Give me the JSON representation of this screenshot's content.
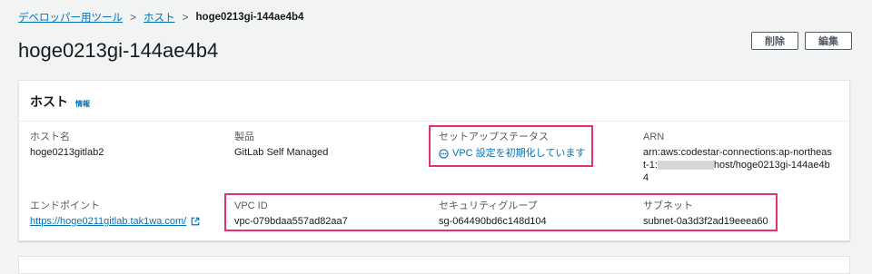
{
  "breadcrumb": {
    "items": [
      "デベロッパー用ツール",
      "ホスト"
    ],
    "separator": ">",
    "current": "hoge0213gi-144ae4b4"
  },
  "page": {
    "title": "hoge0213gi-144ae4b4"
  },
  "actions": {
    "delete_label": "削除",
    "edit_label": "編集"
  },
  "panel": {
    "title": "ホスト",
    "info_label": "情報",
    "fields": {
      "host_name": {
        "label": "ホスト名",
        "value": "hoge0213gitlab2"
      },
      "product": {
        "label": "製品",
        "value": "GitLab Self Managed"
      },
      "setup_status": {
        "label": "セットアップステータス",
        "value": "VPC 設定を初期化しています"
      },
      "arn": {
        "label": "ARN",
        "value_prefix": "arn:aws:codestar-connections:ap-northeast-1:",
        "value_suffix": "host/hoge0213gi-144ae4b4"
      },
      "endpoint": {
        "label": "エンドポイント",
        "value": "https://hoge0211gitlab.tak1wa.com/"
      },
      "vpc_id": {
        "label": "VPC ID",
        "value": "vpc-079bdaa557ad82aa7"
      },
      "security_group": {
        "label": "セキュリティグループ",
        "value": "sg-064490bd6c148d104"
      },
      "subnet": {
        "label": "サブネット",
        "value": "subnet-0a3d3f2ad19eeea60"
      }
    }
  },
  "colors": {
    "link": "#0073bb",
    "highlight": "#e8306a",
    "background": "#f2f3f3"
  },
  "icons": {
    "external": "external-link-icon",
    "status": "status-in-progress-icon"
  }
}
